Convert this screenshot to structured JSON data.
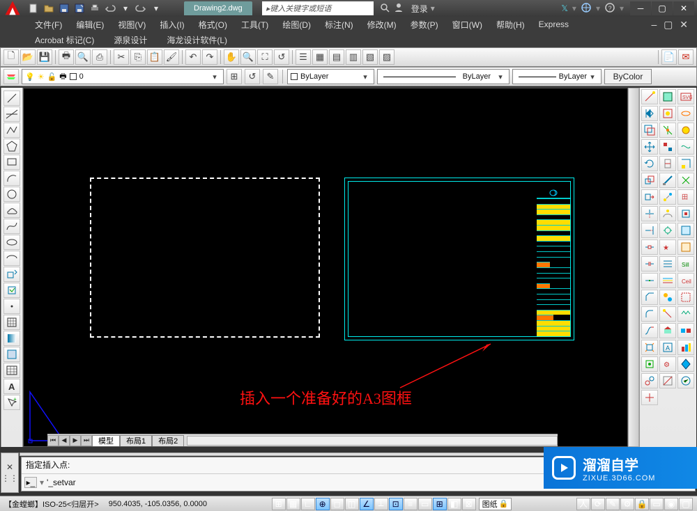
{
  "title": {
    "file_tab": "Drawing2.dwg",
    "search_placeholder": "键入关键字或短语",
    "login": "登录"
  },
  "menus": {
    "row1": [
      "文件(F)",
      "编辑(E)",
      "视图(V)",
      "插入(I)",
      "格式(O)",
      "工具(T)",
      "绘图(D)",
      "标注(N)",
      "修改(M)",
      "参数(P)",
      "窗口(W)",
      "帮助(H)",
      "Express"
    ],
    "row2": [
      "Acrobat 标记(C)",
      "源泉设计",
      "海龙设计软件(L)"
    ]
  },
  "layer": {
    "current": "0",
    "linetype_combo": "ByLayer",
    "lineweight": "ByLayer",
    "lineweight2": "ByLayer",
    "color": "ByColor"
  },
  "layout": {
    "model": "模型",
    "l1": "布局1",
    "l2": "布局2"
  },
  "annotation": "插入一个准备好的A3图框",
  "command": {
    "history": "指定插入点:",
    "current": "'_setvar"
  },
  "status": {
    "left": "【金螳螂】ISO-25<归层开>",
    "coord": "950.4035, -105.0356, 0.0000",
    "combo": "图纸"
  },
  "watermark": {
    "main": "溜溜自学",
    "sub": "ZIXUE.3D66.COM"
  }
}
